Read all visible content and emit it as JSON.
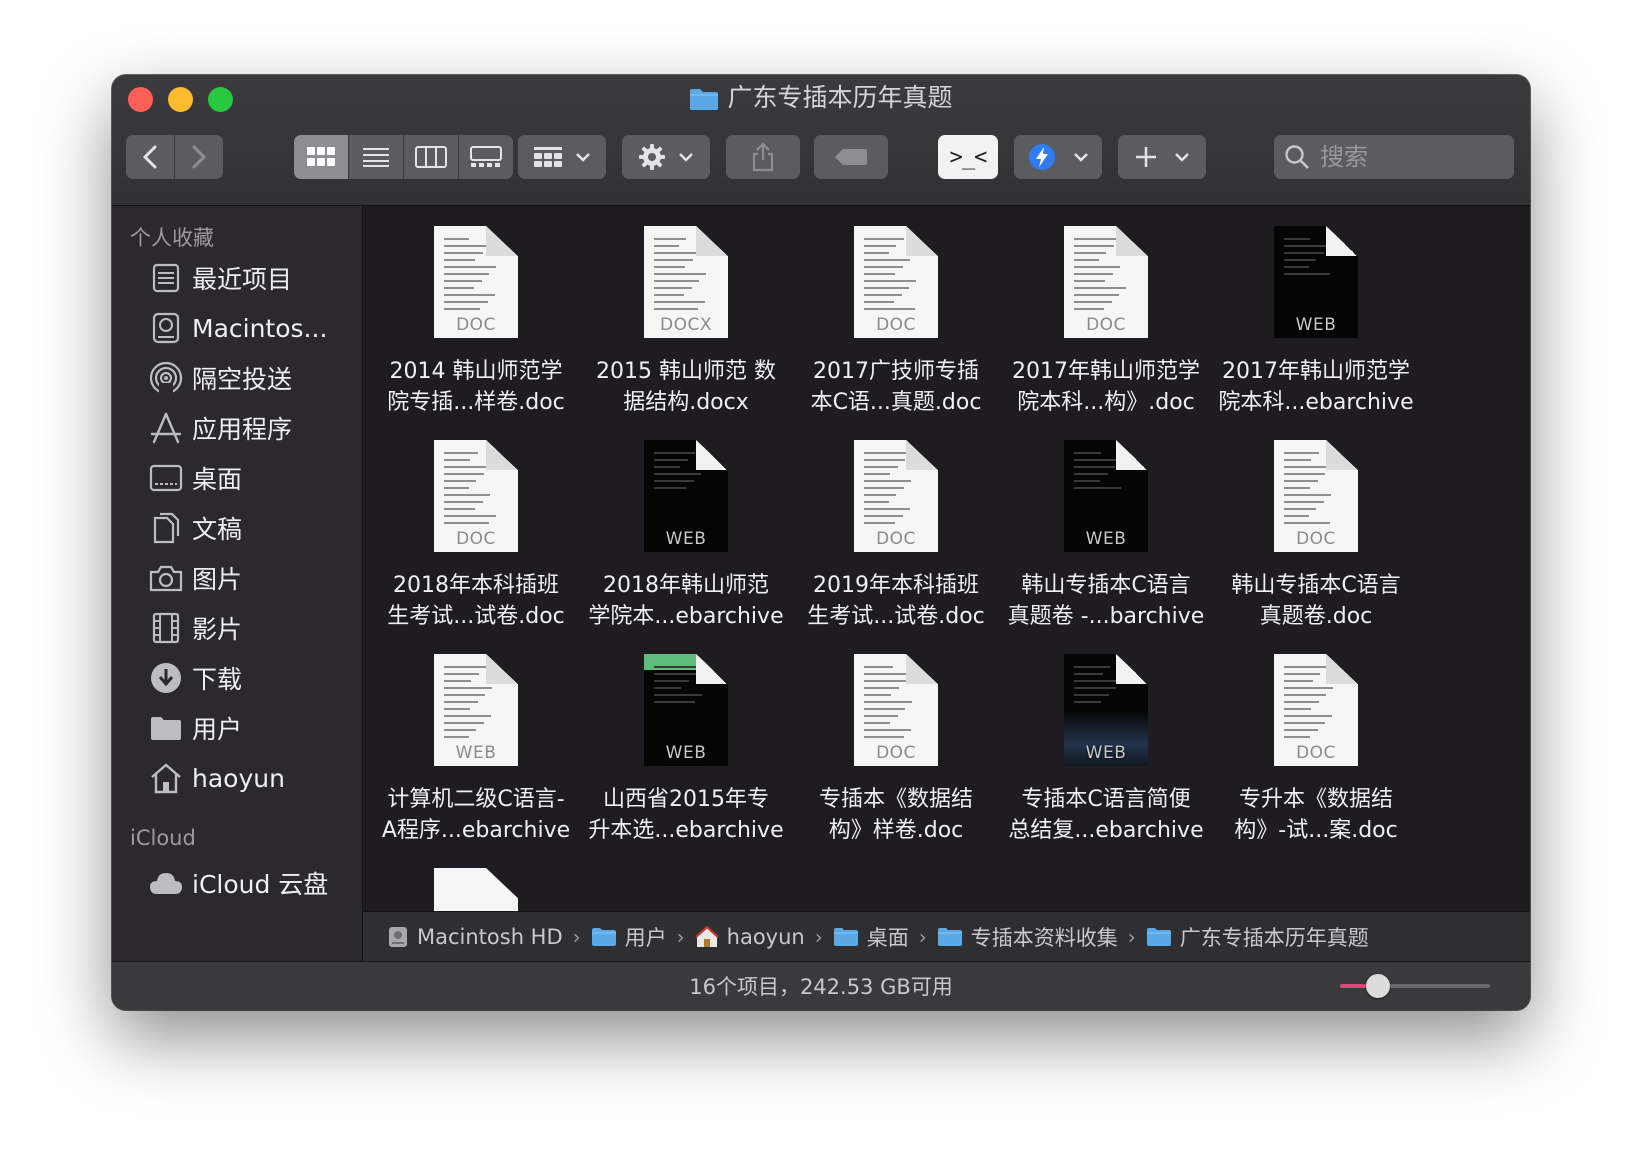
{
  "window": {
    "title": "广东专插本历年真题"
  },
  "toolbar": {
    "search_placeholder": "搜索",
    "terminal_label": ">_<"
  },
  "sidebar": {
    "favorites_header": "个人收藏",
    "favorites": [
      {
        "label": "最近项目",
        "icon": "recents-icon"
      },
      {
        "label": "Macintos...",
        "icon": "harddisk-icon"
      },
      {
        "label": "隔空投送",
        "icon": "airdrop-icon"
      },
      {
        "label": "应用程序",
        "icon": "applications-icon"
      },
      {
        "label": "桌面",
        "icon": "desktop-icon"
      },
      {
        "label": "文稿",
        "icon": "documents-icon"
      },
      {
        "label": "图片",
        "icon": "pictures-icon"
      },
      {
        "label": "影片",
        "icon": "movies-icon"
      },
      {
        "label": "下载",
        "icon": "downloads-icon"
      },
      {
        "label": "用户",
        "icon": "folder-icon"
      },
      {
        "label": "haoyun",
        "icon": "home-icon"
      }
    ],
    "icloud_header": "iCloud",
    "icloud": [
      {
        "label": "iCloud 云盘",
        "icon": "cloud-icon"
      }
    ]
  },
  "files": [
    {
      "line1": "2014 韩山师范学",
      "line2": "院专插...样卷.doc",
      "ext": "DOC",
      "style": "light"
    },
    {
      "line1": "2015 韩山师范 数",
      "line2": "据结构.docx",
      "ext": "DOCX",
      "style": "light"
    },
    {
      "line1": "2017广技师专插",
      "line2": "本C语...真题.doc",
      "ext": "DOC",
      "style": "light"
    },
    {
      "line1": "2017年韩山师范学",
      "line2": "院本科...构》.doc",
      "ext": "DOC",
      "style": "light"
    },
    {
      "line1": "2017年韩山师范学",
      "line2": "院本科...ebarchive",
      "ext": "WEB",
      "style": "dark"
    },
    {
      "line1": "2018年本科插班",
      "line2": "生考试...试卷.doc",
      "ext": "DOC",
      "style": "light"
    },
    {
      "line1": "2018年韩山师范",
      "line2": "学院本...ebarchive",
      "ext": "WEB",
      "style": "dark"
    },
    {
      "line1": "2019年本科插班",
      "line2": "生考试...试卷.doc",
      "ext": "DOC",
      "style": "light"
    },
    {
      "line1": "韩山专插本C语言",
      "line2": "真题卷 -...barchive",
      "ext": "WEB",
      "style": "dark"
    },
    {
      "line1": "韩山专插本C语言",
      "line2": "真题卷.doc",
      "ext": "DOC",
      "style": "light"
    },
    {
      "line1": "计算机二级C语言-",
      "line2": "A程序...ebarchive",
      "ext": "WEB",
      "style": "light"
    },
    {
      "line1": "山西省2015年专",
      "line2": "升本选...ebarchive",
      "ext": "WEB",
      "style": "dark-tab"
    },
    {
      "line1": "专插本《数据结",
      "line2": "构》样卷.doc",
      "ext": "DOC",
      "style": "light"
    },
    {
      "line1": "专插本C语言简便",
      "line2": "总结复...ebarchive",
      "ext": "WEB",
      "style": "dark-wave"
    },
    {
      "line1": "专升本《数据结",
      "line2": "构》-试...案.doc",
      "ext": "DOC",
      "style": "light"
    }
  ],
  "path": [
    {
      "label": "Macintosh HD",
      "icon": "harddisk-icon"
    },
    {
      "label": "用户",
      "icon": "folder-icon"
    },
    {
      "label": "haoyun",
      "icon": "home-icon"
    },
    {
      "label": "桌面",
      "icon": "folder-icon"
    },
    {
      "label": "专插本资料收集",
      "icon": "folder-icon"
    },
    {
      "label": "广东专插本历年真题",
      "icon": "folder-icon"
    }
  ],
  "status": {
    "text": "16个项目，242.53 GB可用",
    "icon_size_level": 0.25
  },
  "colors": {
    "accent": "#e0467a",
    "folder": "#5aa9e6"
  }
}
